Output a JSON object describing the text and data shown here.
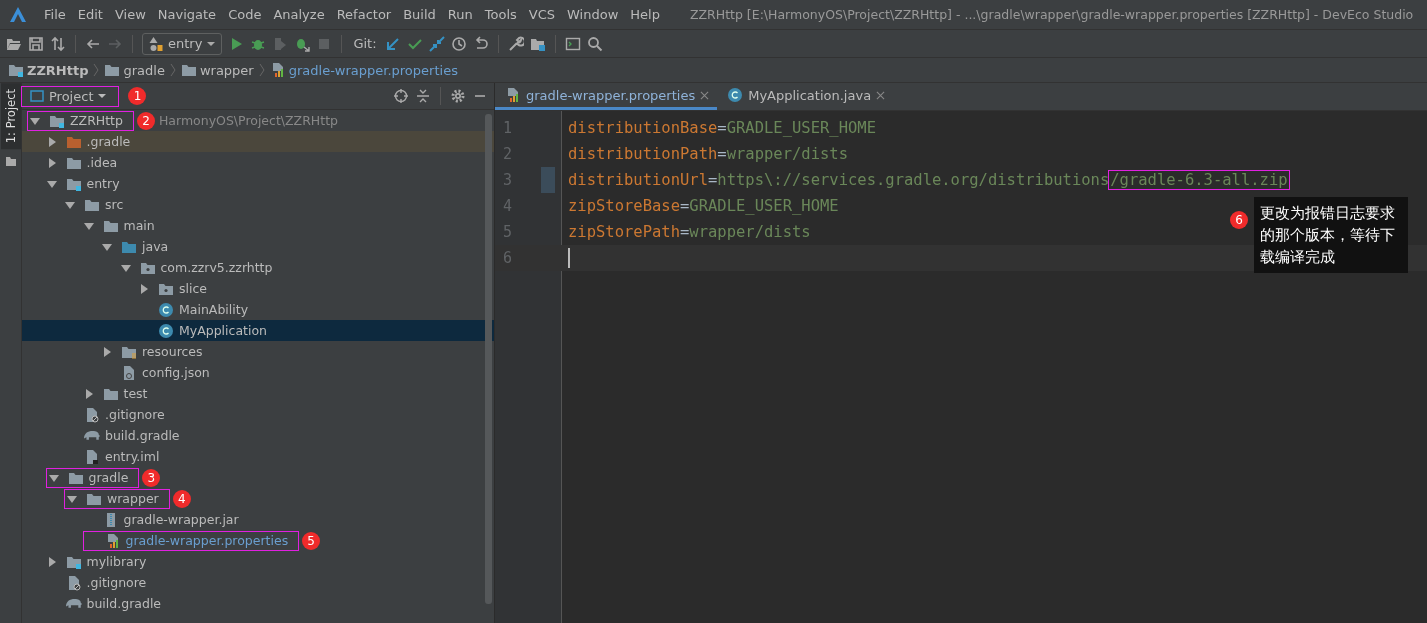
{
  "window": {
    "title": "ZZRHttp [E:\\HarmonyOS\\Project\\ZZRHttp] - ...\\gradle\\wrapper\\gradle-wrapper.properties [ZZRHttp] - DevEco Studio"
  },
  "menu": [
    "File",
    "Edit",
    "View",
    "Navigate",
    "Code",
    "Analyze",
    "Refactor",
    "Build",
    "Run",
    "Tools",
    "VCS",
    "Window",
    "Help"
  ],
  "toolbar": {
    "run_config": "entry",
    "git_label": "Git:"
  },
  "breadcrumb": [
    {
      "label": "ZZRHttp",
      "kind": "module"
    },
    {
      "label": "gradle",
      "kind": "folder"
    },
    {
      "label": "wrapper",
      "kind": "folder"
    },
    {
      "label": "gradle-wrapper.properties",
      "kind": "properties"
    }
  ],
  "side_strip": {
    "label": "1: Project"
  },
  "project_panel": {
    "view": "Project",
    "badge": "1",
    "tree": [
      {
        "name": "ZZRHttp",
        "kind": "module",
        "expanded": true,
        "path": "HarmonyOS\\Project\\ZZRHttp",
        "badge": "2",
        "children": [
          {
            "name": ".gradle",
            "kind": "excluded",
            "expanded": false,
            "highlighted": true
          },
          {
            "name": ".idea",
            "kind": "folder",
            "expanded": false
          },
          {
            "name": "entry",
            "kind": "module",
            "expanded": true,
            "children": [
              {
                "name": "src",
                "kind": "folder",
                "expanded": true,
                "children": [
                  {
                    "name": "main",
                    "kind": "folder",
                    "expanded": true,
                    "children": [
                      {
                        "name": "java",
                        "kind": "source",
                        "expanded": true,
                        "children": [
                          {
                            "name": "com.zzrv5.zzrhttp",
                            "kind": "package",
                            "expanded": true,
                            "children": [
                              {
                                "name": "slice",
                                "kind": "package",
                                "expanded": false
                              },
                              {
                                "name": "MainAbility",
                                "kind": "class",
                                "selected": false
                              },
                              {
                                "name": "MyApplication",
                                "kind": "class",
                                "selected": true
                              }
                            ]
                          }
                        ]
                      },
                      {
                        "name": "resources",
                        "kind": "resources",
                        "expanded": false
                      },
                      {
                        "name": "config.json",
                        "kind": "json"
                      }
                    ]
                  },
                  {
                    "name": "test",
                    "kind": "folder",
                    "expanded": false
                  }
                ]
              },
              {
                "name": ".gitignore",
                "kind": "ignore"
              },
              {
                "name": "build.gradle",
                "kind": "gradle"
              },
              {
                "name": "entry.iml",
                "kind": "iml"
              }
            ]
          },
          {
            "name": "gradle",
            "kind": "folder",
            "expanded": true,
            "badge": "3",
            "children": [
              {
                "name": "wrapper",
                "kind": "folder",
                "expanded": true,
                "badge": "4",
                "children": [
                  {
                    "name": "gradle-wrapper.jar",
                    "kind": "jar"
                  },
                  {
                    "name": "gradle-wrapper.properties",
                    "kind": "properties",
                    "modified": true,
                    "badge": "5"
                  }
                ]
              }
            ]
          },
          {
            "name": "mylibrary",
            "kind": "module",
            "expanded": false
          },
          {
            "name": ".gitignore",
            "kind": "ignore"
          },
          {
            "name": "build.gradle",
            "kind": "gradle"
          }
        ]
      }
    ]
  },
  "editor": {
    "tabs": [
      {
        "label": "gradle-wrapper.properties",
        "kind": "properties",
        "selected": true
      },
      {
        "label": "MyApplication.java",
        "kind": "class",
        "selected": false
      }
    ],
    "lines": [
      {
        "number": "1",
        "key": "distributionBase",
        "separator": "=",
        "value": "GRADLE_USER_HOME"
      },
      {
        "number": "2",
        "key": "distributionPath",
        "separator": "=",
        "value": "wrapper/dists"
      },
      {
        "number": "3",
        "key": "distributionUrl",
        "separator": "=",
        "value": "https\\://services.gradle.org/distributions",
        "annotated": "/gradle-6.3-all.zip",
        "changed": true
      },
      {
        "number": "4",
        "key": "zipStoreBase",
        "separator": "=",
        "value": "GRADLE_USER_HOME"
      },
      {
        "number": "5",
        "key": "zipStorePath",
        "separator": "=",
        "value": "wrapper/dists"
      },
      {
        "number": "6",
        "current": true
      }
    ],
    "callout": {
      "badge": "6",
      "text": "更改为报错日志要求的那个版本，等待下载编译完成"
    }
  }
}
